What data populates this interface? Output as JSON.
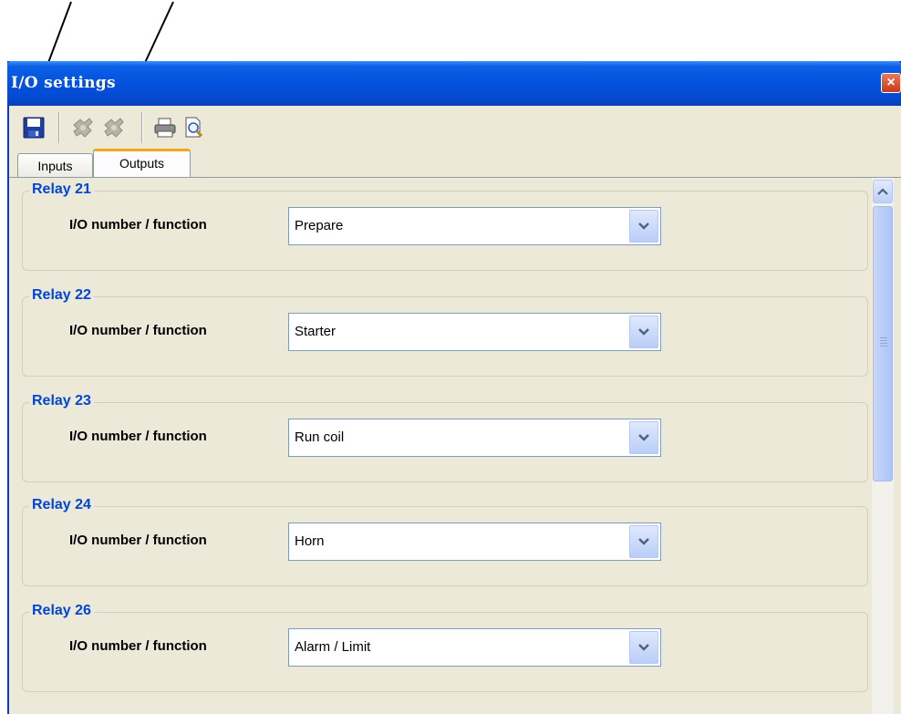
{
  "window": {
    "title": "I/O settings",
    "close_label": "×"
  },
  "toolbar": {
    "buttons": [
      {
        "icon": "save-icon",
        "enabled": true
      },
      {
        "icon": "import-icon",
        "enabled": false
      },
      {
        "icon": "export-icon",
        "enabled": false
      },
      {
        "icon": "print-icon",
        "enabled": true
      },
      {
        "icon": "print-preview-icon",
        "enabled": true
      }
    ]
  },
  "tabs": [
    {
      "label": "Inputs",
      "active": false
    },
    {
      "label": "Outputs",
      "active": true
    }
  ],
  "relays": [
    {
      "title": "Relay 21",
      "field_label": "I/O number / function",
      "value": "Prepare"
    },
    {
      "title": "Relay 22",
      "field_label": "I/O number / function",
      "value": "Starter"
    },
    {
      "title": "Relay 23",
      "field_label": "I/O number / function",
      "value": "Run coil"
    },
    {
      "title": "Relay 24",
      "field_label": "I/O number / function",
      "value": "Horn"
    },
    {
      "title": "Relay 26",
      "field_label": "I/O number / function",
      "value": "Alarm / Limit"
    }
  ],
  "colors": {
    "titlebar": "#0452dd",
    "group_title": "#0046d5",
    "tab_highlight": "#f3a61c",
    "dialog_background": "#ece9d8"
  }
}
